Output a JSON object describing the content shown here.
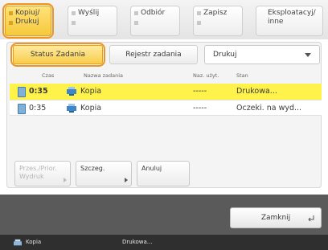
{
  "tabs": [
    {
      "label": "Kopiuj/ Drukuj",
      "active": true
    },
    {
      "label": "Wyślij",
      "active": false
    },
    {
      "label": "Odbiór",
      "active": false
    },
    {
      "label": "Zapisz",
      "active": false
    },
    {
      "label": "Eksploatacyj/ inne",
      "active": false
    }
  ],
  "subtabs": {
    "status": "Status Zadania",
    "log": "Rejestr zadania"
  },
  "job_type_select": {
    "value": "Drukuj"
  },
  "table": {
    "headers": {
      "time": "Czas",
      "name": "Nazwa zadania",
      "user": "Naz. użyt.",
      "status": "Stan"
    },
    "rows": [
      {
        "time": "0:35",
        "name": "Kopia",
        "user": "-----",
        "status": "Drukowa...",
        "selected": true
      },
      {
        "time": "0:35",
        "name": "Kopia",
        "user": "-----",
        "status": "Oczeki. na wyd...",
        "selected": false
      }
    ]
  },
  "buttons": {
    "priority": "Przes./Prior. Wydruk",
    "details": "Szczeg.",
    "cancel": "Anuluj",
    "close": "Zamknij"
  },
  "status_bar": {
    "job_name": "Kopia",
    "job_status": "Drukowa..."
  },
  "colors": {
    "selected_row": "#fff24a",
    "active_tab": "#f7cd4c",
    "highlight": "#f2941c"
  }
}
